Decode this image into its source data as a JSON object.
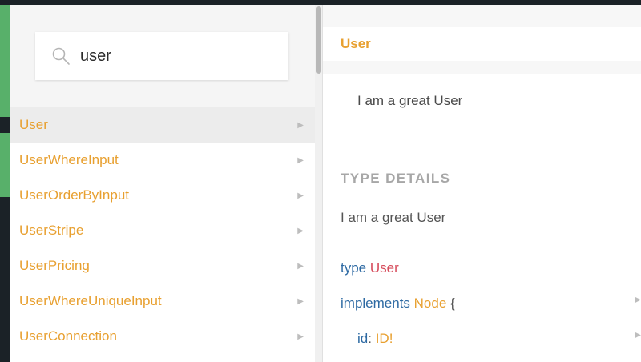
{
  "search": {
    "value": "user",
    "icon": "search-icon"
  },
  "types": [
    {
      "name": "User",
      "active": true
    },
    {
      "name": "UserWhereInput",
      "active": false
    },
    {
      "name": "UserOrderByInput",
      "active": false
    },
    {
      "name": "UserStripe",
      "active": false
    },
    {
      "name": "UserPricing",
      "active": false
    },
    {
      "name": "UserWhereUniqueInput",
      "active": false
    },
    {
      "name": "UserConnection",
      "active": false
    }
  ],
  "arrow_glyph": "▶",
  "detail": {
    "title": "User",
    "description": "I am a great User",
    "section_title": "TYPE DETAILS",
    "type_description": "I am a great User",
    "code": {
      "kw_type": "type",
      "type_name": "User",
      "kw_implements": "implements",
      "interface_name": "Node",
      "open_brace": "{",
      "field_name": "id",
      "colon": ":",
      "field_type": "ID!"
    }
  },
  "colors": {
    "accent_orange": "#e8a030",
    "keyword_blue": "#2e6aa3",
    "type_red": "#d64a5a",
    "sidebar_green": "#58b06a"
  }
}
